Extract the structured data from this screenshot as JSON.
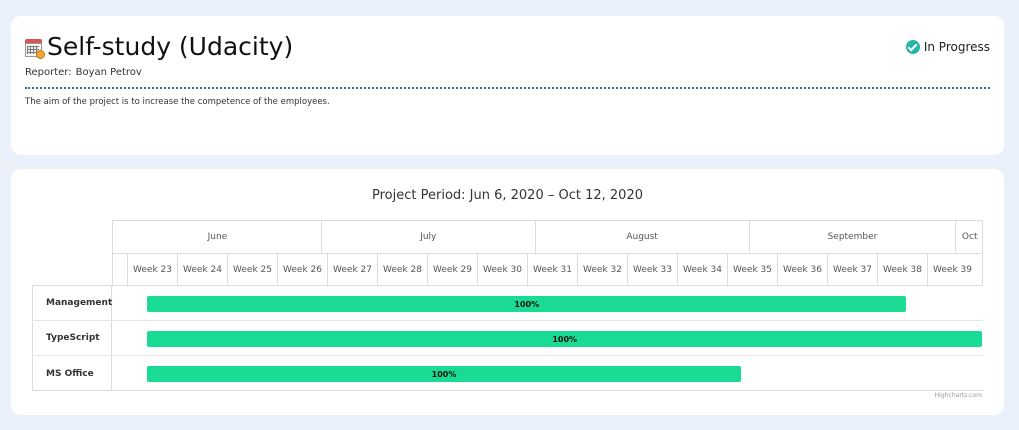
{
  "project": {
    "title": "Self-study (Udacity)",
    "reporter_label": "Reporter:",
    "reporter_name": "Boyan Petrov",
    "status": "In Progress",
    "description": "The aim of the project is to increase the competence of the employees."
  },
  "icons": {
    "project": "calendar-clock-icon",
    "status": "check-circle-icon"
  },
  "colors": {
    "bar": "#19db94",
    "status": "#26b5a6",
    "divider": "#2f6e99"
  },
  "chart_data": {
    "type": "gantt",
    "title": "Project Period: Jun 6, 2020 – Oct 12, 2020",
    "months": [
      "June",
      "July",
      "August",
      "September",
      "Oct"
    ],
    "weeks": [
      "Week 23",
      "Week 24",
      "Week 25",
      "Week 26",
      "Week 27",
      "Week 28",
      "Week 29",
      "Week 30",
      "Week 31",
      "Week 32",
      "Week 33",
      "Week 34",
      "Week 35",
      "Week 36",
      "Week 37",
      "Week 38",
      "Week 39"
    ],
    "tasks": [
      {
        "name": "Management",
        "start": "2020-06-06",
        "end": "2020-09-24",
        "completed": "100%"
      },
      {
        "name": "TypeScript",
        "start": "2020-06-06",
        "end": "2020-10-12",
        "completed": "100%"
      },
      {
        "name": "MS Office",
        "start": "2020-06-06",
        "end": "2020-08-31",
        "completed": "100%"
      }
    ],
    "credits": "Highcharts.com"
  }
}
